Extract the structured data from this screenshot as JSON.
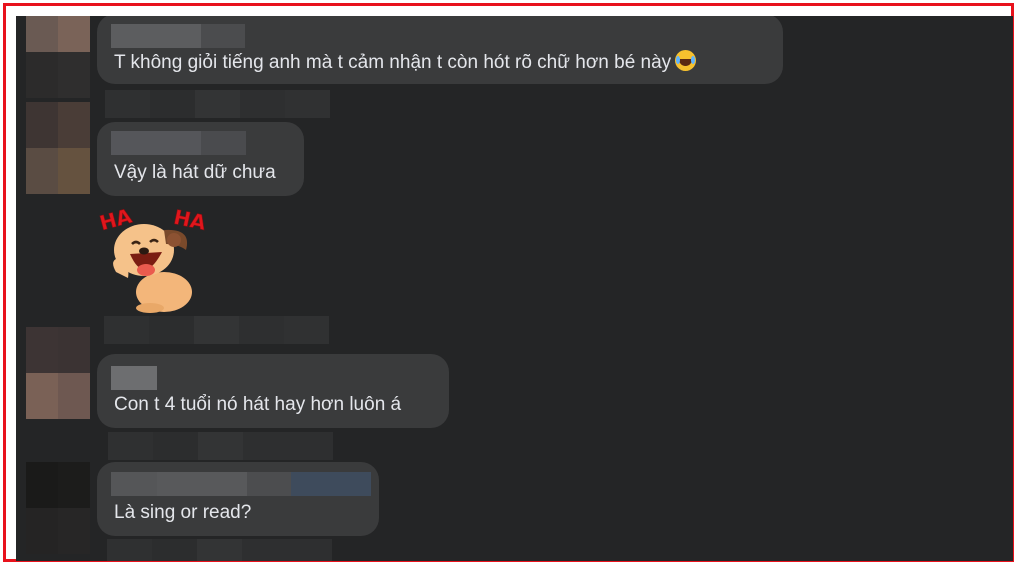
{
  "comments": [
    {
      "text": "T không giỏi tiếng anh mà t cảm nhận t còn hót rõ chữ hơn bé này",
      "emoji": "crying-laughing-emoji",
      "avatar_colors": [
        "#6a5a53",
        "#7a6358",
        "#2c2b2b",
        "#2f2e2e"
      ],
      "name_colors": [
        "#5c5d5f",
        "#4b4c4e"
      ]
    },
    {
      "text": "Vậy là hát dữ chưa",
      "avatar_colors": [
        "#3e3533",
        "#4a3d37",
        "#5a4c43",
        "#65523f"
      ],
      "name_colors": [
        "#55565a",
        "#4a4b4e"
      ]
    },
    {
      "sticker": "ha-ha-dog-sticker",
      "sticker_text": [
        "HA",
        "HA"
      ]
    },
    {
      "text": "Con t 4 tuổi nó hát hay hơn luôn á",
      "avatar_colors": [
        "#3d3434",
        "#3b3333",
        "#7a6156",
        "#6e5851"
      ],
      "name_colors": [
        "#6d6e70"
      ]
    },
    {
      "text": "Là sing or read?",
      "avatar_colors": [
        "#1a1a19",
        "#1c1c1b",
        "#252424",
        "#272626"
      ],
      "name_colors": [
        "#555658",
        "#58595b",
        "#4c4d4f",
        "#3e4b5c"
      ]
    }
  ],
  "colors": {
    "background": "#242526",
    "bubble": "#3a3b3c",
    "text": "#e4e6eb",
    "frame_border": "#e8121c"
  }
}
